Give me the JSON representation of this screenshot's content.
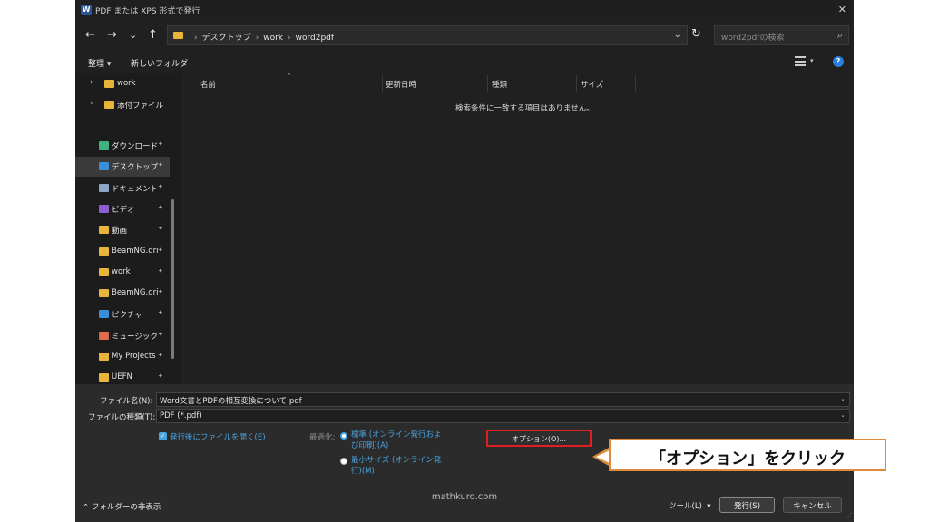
{
  "window": {
    "title": "PDF または XPS 形式で発行",
    "app_icon": "W"
  },
  "nav": {
    "back": "←",
    "forward": "→",
    "history": "⌄",
    "up": "↑",
    "breadcrumb": [
      "デスクトップ",
      "work",
      "word2pdf"
    ],
    "search_placeholder": "word2pdfの検索"
  },
  "command_bar": {
    "organize": "整理 ▾",
    "new_folder": "新しいフォルダー"
  },
  "sidebar": {
    "tree_items": [
      {
        "label": "work",
        "expand": "›"
      },
      {
        "label": "添付ファイル",
        "expand": "›"
      }
    ],
    "quick_access": [
      {
        "label": "ダウンロード",
        "icon": "download-icon",
        "color": "#3fb37f",
        "selected": false
      },
      {
        "label": "デスクトップ",
        "icon": "desktop-icon",
        "color": "#3a8fd9",
        "selected": true
      },
      {
        "label": "ドキュメント",
        "icon": "document-icon",
        "color": "#8ea6c8",
        "selected": false
      },
      {
        "label": "ビデオ",
        "icon": "video-icon",
        "color": "#8b5fd0",
        "selected": false
      },
      {
        "label": "動画",
        "icon": "folder-icon",
        "color": "#e8b53a",
        "selected": false
      },
      {
        "label": "BeamNG.driv",
        "icon": "folder-icon",
        "color": "#e8b53a",
        "selected": false
      },
      {
        "label": "work",
        "icon": "folder-icon",
        "color": "#e8b53a",
        "selected": false
      },
      {
        "label": "BeamNG.driv",
        "icon": "folder-icon",
        "color": "#e8b53a",
        "selected": false
      },
      {
        "label": "ピクチャ",
        "icon": "pictures-icon",
        "color": "#3a8fd9",
        "selected": false
      },
      {
        "label": "ミュージック",
        "icon": "music-icon",
        "color": "#e06a4a",
        "selected": false
      },
      {
        "label": "My Projects",
        "icon": "folder-icon",
        "color": "#e8b53a",
        "selected": false
      },
      {
        "label": "UEFN",
        "icon": "folder-icon",
        "color": "#e8b53a",
        "selected": false
      }
    ],
    "pin": "📌"
  },
  "file_list": {
    "columns": [
      "名前",
      "更新日時",
      "種類",
      "サイズ"
    ],
    "empty_message": "検索条件に一致する項目はありません。"
  },
  "form": {
    "filename_label": "ファイル名(N):",
    "filename_value": "Word文書とPDFの相互変換について.pdf",
    "filetype_label": "ファイルの種類(T):",
    "filetype_value": "PDF (*.pdf)",
    "open_after_publish": "発行後にファイルを開く(E)",
    "optimize_label": "最適化:",
    "standard_line1": "標準 (オンライン発行およ",
    "standard_line2": "び印刷)(A)",
    "minimum_line1": "最小サイズ (オンライン発",
    "minimum_line2": "行)(M)",
    "options_button": "オプション(O)..."
  },
  "footer": {
    "hide_folders": "フォルダーの非表示",
    "tools": "ツール(L)",
    "publish": "発行(S)",
    "cancel": "キャンセル"
  },
  "annotation": {
    "callout": "「オプション」をクリック",
    "watermark": "mathkuro.com"
  }
}
